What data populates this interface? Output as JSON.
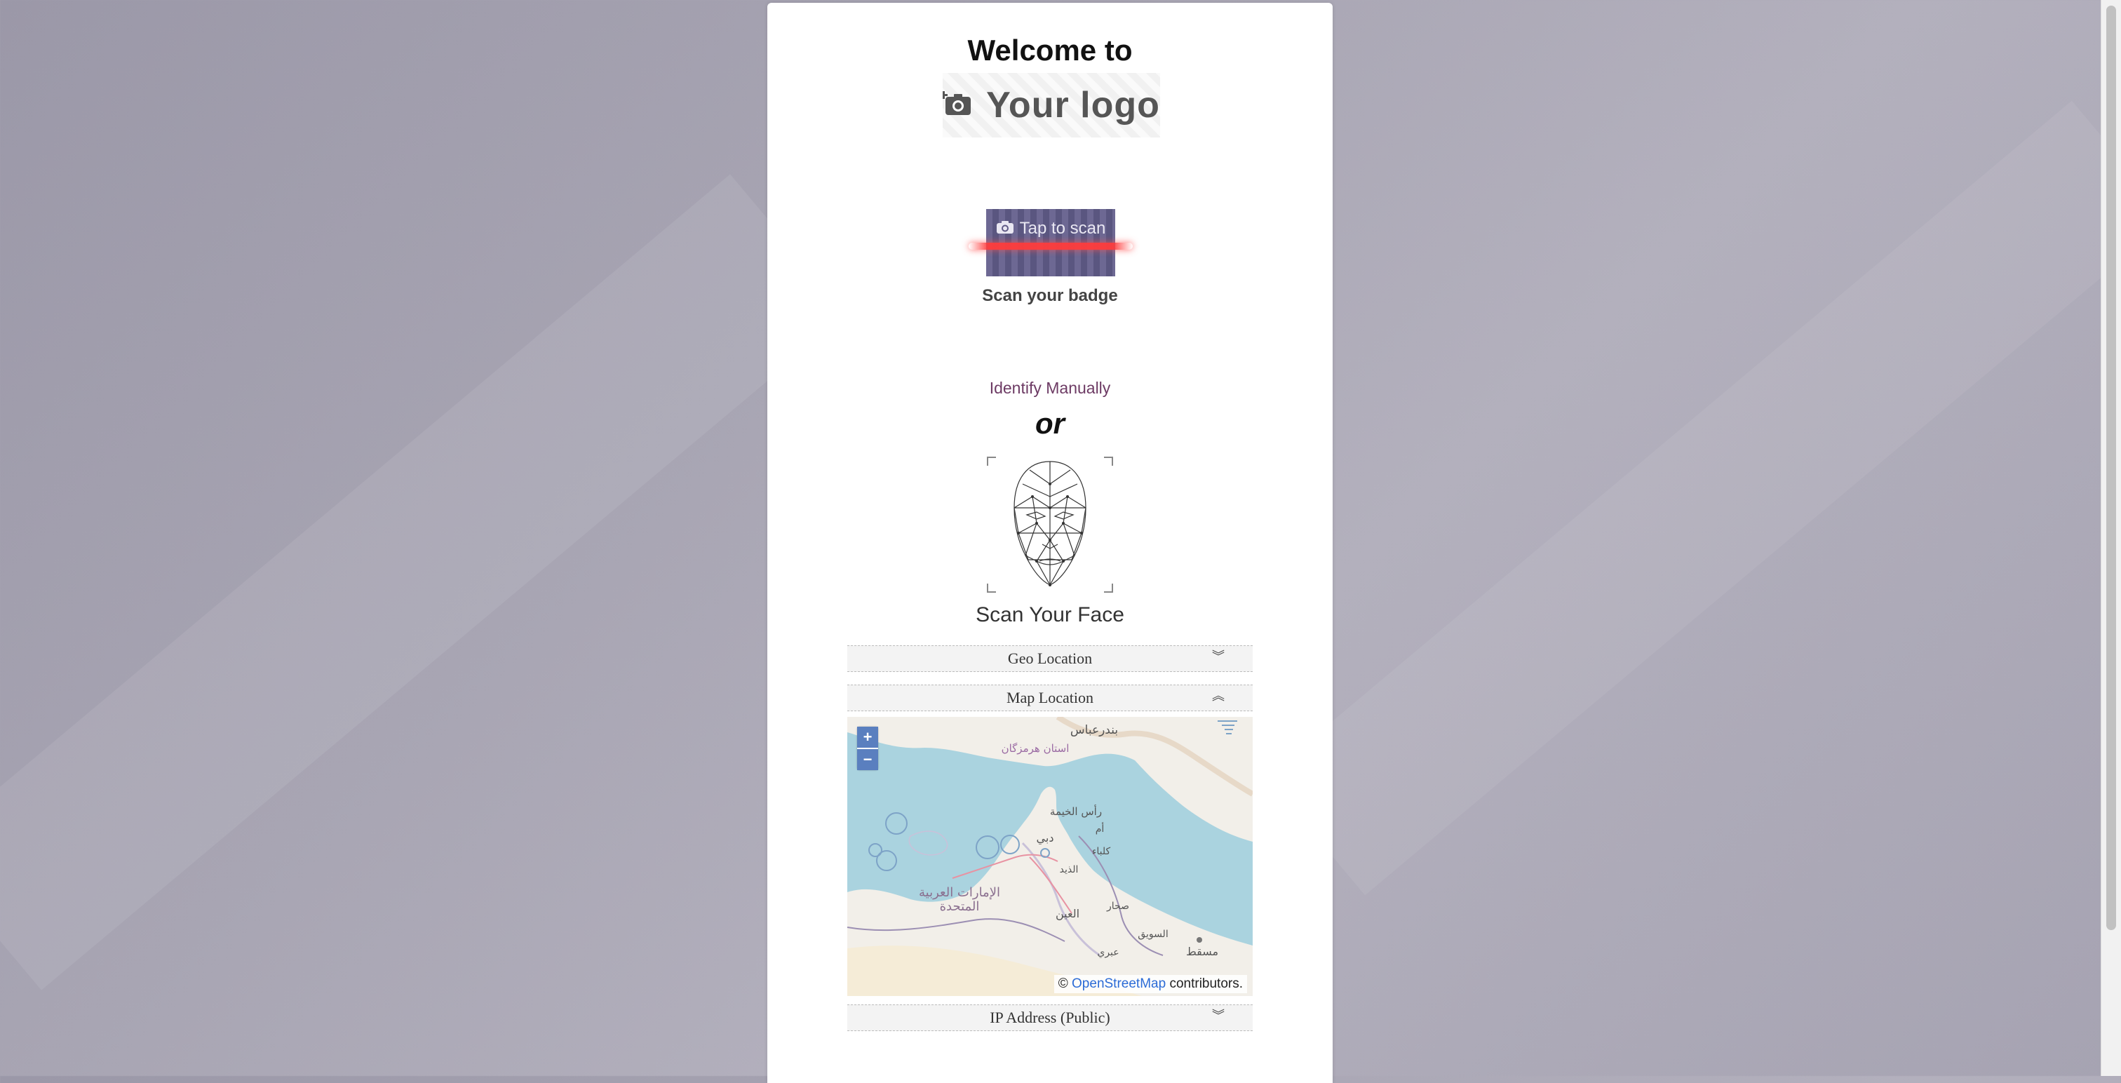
{
  "welcome": "Welcome to",
  "logo": {
    "text": "Your logo",
    "icon": "camera-plus-icon"
  },
  "badge_scan": {
    "button_label": "Tap to scan",
    "caption": "Scan your badge",
    "icon": "camera-icon"
  },
  "identify_manually": "Identify Manually",
  "or_text": "or",
  "face_scan": {
    "caption": "Scan Your Face"
  },
  "panels": {
    "geo_location": "Geo Location",
    "map_location": "Map Location",
    "ip_address": "IP Address (Public)"
  },
  "map": {
    "zoom_in": "+",
    "zoom_out": "−",
    "attribution_prefix": "©",
    "attribution_link": "OpenStreetMap",
    "attribution_suffix": "contributors.",
    "labels": {
      "bandar_abbas": "بندرعباس",
      "hormozgan": "استان هرمزگان",
      "ras_al_khaimah": "رأس الخيمة",
      "umm": "أم",
      "dubai": "دبي",
      "kalba": "كلباء",
      "al_dhaid": "الذيد",
      "uae": "الإمارات العربية",
      "uae2": "المتحدة",
      "al_ain": "العين",
      "sohar": "صحار",
      "al_suwaiq": "السويق",
      "muscat": "مسقط",
      "ibri": "عبري"
    }
  },
  "colors": {
    "accent": "#6d3b64",
    "scan_button": "#615c88",
    "scan_line": "#ff3c3c"
  }
}
